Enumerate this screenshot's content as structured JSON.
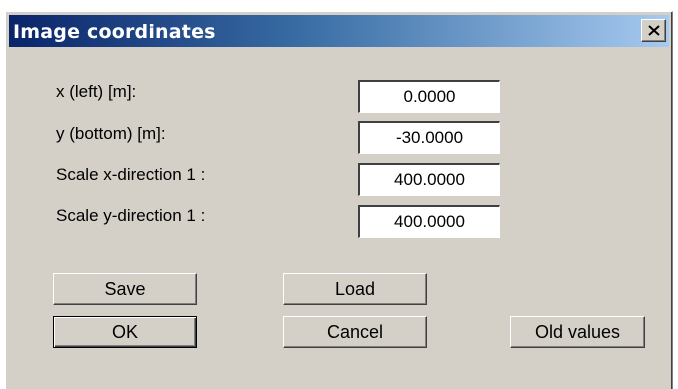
{
  "window": {
    "title": "Image coordinates",
    "close_icon": "close-icon"
  },
  "fields": [
    {
      "label": "x (left) [m]:",
      "value": "0.0000"
    },
    {
      "label": "y (bottom) [m]:",
      "value": "-30.0000"
    },
    {
      "label": "Scale x-direction 1 :",
      "value": "400.0000"
    },
    {
      "label": "Scale y-direction 1 :",
      "value": "400.0000"
    }
  ],
  "buttons": {
    "save": "Save",
    "load": "Load",
    "ok": "OK",
    "cancel": "Cancel",
    "old_values": "Old values"
  }
}
